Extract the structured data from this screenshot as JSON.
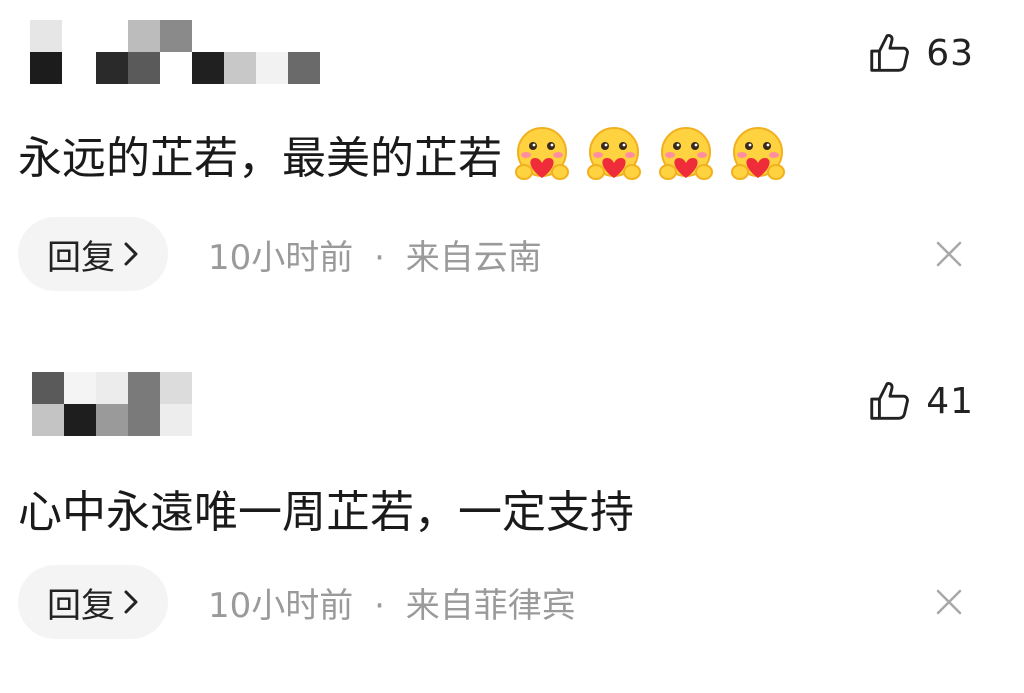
{
  "comments": [
    {
      "like_count": "63",
      "text": "永远的芷若，最美的芷若",
      "emoji": "hug-heart-emoji",
      "emoji_count": 4,
      "reply_label": "回复",
      "time": "10小时前",
      "dot": "·",
      "location": "来自云南"
    },
    {
      "like_count": "41",
      "text": "心中永遠唯一周芷若，一定支持",
      "reply_label": "回复",
      "time": "10小时前",
      "dot": "·",
      "location": "来自菲律宾"
    }
  ],
  "icons": {
    "like": "thumbs-up-icon",
    "reply_arrow": "chevron-right-icon",
    "close": "close-icon"
  },
  "colors": {
    "meta_gray": "#9a9a9a",
    "reply_bg": "#f4f4f4",
    "text": "#1a1a1a"
  }
}
